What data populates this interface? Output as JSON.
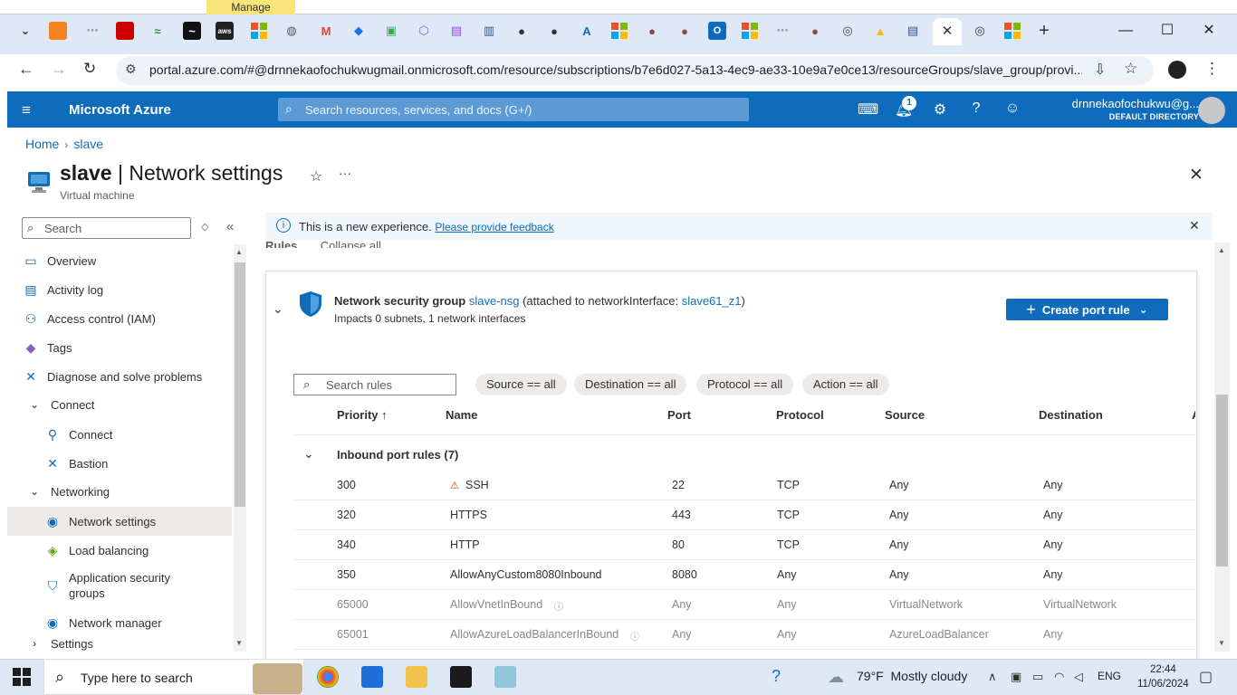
{
  "browser": {
    "manage_tag": "Manage",
    "url": "portal.azure.com/#@drnnekaofochukwugmail.onmicrosoft.com/resource/subscriptions/b7e6d027-5a13-4ec9-ae33-10e9a7e0ce13/resourceGroups/slave_group/provi..."
  },
  "header": {
    "brand": "Microsoft Azure",
    "search_placeholder": "Search resources, services, and docs (G+/)",
    "notification_count": "1",
    "user_name": "drnnekaofochukwu@g...",
    "directory": "DEFAULT DIRECTORY"
  },
  "breadcrumb": {
    "home": "Home",
    "current": "slave"
  },
  "page": {
    "resource": "slave",
    "section": "Network settings",
    "subtitle": "Virtual machine"
  },
  "sidebar": {
    "search_placeholder": "Search",
    "items": [
      {
        "label": "Overview"
      },
      {
        "label": "Activity log"
      },
      {
        "label": "Access control (IAM)"
      },
      {
        "label": "Tags"
      },
      {
        "label": "Diagnose and solve problems"
      },
      {
        "label": "Connect"
      },
      {
        "label": "Connect"
      },
      {
        "label": "Bastion"
      },
      {
        "label": "Networking"
      },
      {
        "label": "Network settings"
      },
      {
        "label": "Load balancing"
      },
      {
        "label": "Application security groups"
      },
      {
        "label": "Network manager"
      },
      {
        "label": "Settings"
      }
    ]
  },
  "banner": {
    "text": "This is a new experience.",
    "link": "Please provide feedback"
  },
  "rules_header": {
    "title": "Rules",
    "collapse": "Collapse all"
  },
  "nsg": {
    "prefix": "Network security group",
    "name": "slave-nsg",
    "attached_prefix": "(attached to networkInterface:",
    "nic": "slave61_z1",
    "attached_suffix": ")",
    "impacts": "Impacts 0 subnets, 1 network interfaces",
    "create_button": "Create port rule"
  },
  "filters": {
    "search_placeholder": "Search rules",
    "source": "Source == all",
    "destination": "Destination == all",
    "protocol": "Protocol == all",
    "action": "Action == all"
  },
  "columns": {
    "priority": "Priority ↑",
    "name": "Name",
    "port": "Port",
    "protocol": "Protocol",
    "source": "Source",
    "destination": "Destination",
    "action": "A"
  },
  "inbound_group": "Inbound port rules (7)",
  "rules": [
    {
      "priority": "300",
      "name": "SSH",
      "port": "22",
      "protocol": "TCP",
      "source": "Any",
      "destination": "Any"
    },
    {
      "priority": "320",
      "name": "HTTPS",
      "port": "443",
      "protocol": "TCP",
      "source": "Any",
      "destination": "Any"
    },
    {
      "priority": "340",
      "name": "HTTP",
      "port": "80",
      "protocol": "TCP",
      "source": "Any",
      "destination": "Any"
    },
    {
      "priority": "350",
      "name": "AllowAnyCustom8080Inbound",
      "port": "8080",
      "protocol": "Any",
      "source": "Any",
      "destination": "Any"
    },
    {
      "priority": "65000",
      "name": "AllowVnetInBound",
      "port": "Any",
      "protocol": "Any",
      "source": "VirtualNetwork",
      "destination": "VirtualNetwork"
    },
    {
      "priority": "65001",
      "name": "AllowAzureLoadBalancerInBound",
      "port": "Any",
      "protocol": "Any",
      "source": "AzureLoadBalancer",
      "destination": "Any"
    }
  ],
  "taskbar": {
    "search_placeholder": "Type here to search",
    "temperature": "79°F",
    "weather": "Mostly cloudy",
    "language": "ENG",
    "time": "22:44",
    "date": "11/06/2024"
  },
  "colors": {
    "azure_blue": "#0f6cbd",
    "warning": "#d83b01"
  }
}
